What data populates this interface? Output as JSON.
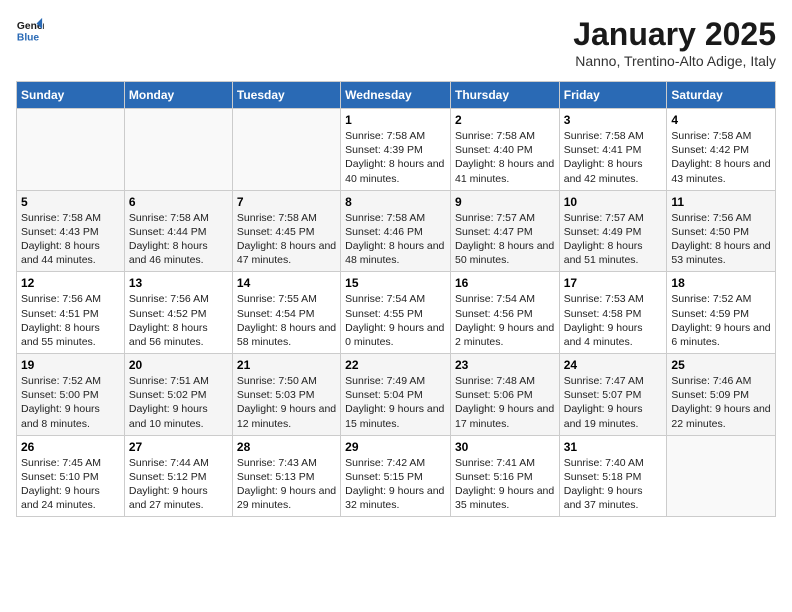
{
  "header": {
    "logo_line1": "General",
    "logo_line2": "Blue",
    "month": "January 2025",
    "location": "Nanno, Trentino-Alto Adige, Italy"
  },
  "weekdays": [
    "Sunday",
    "Monday",
    "Tuesday",
    "Wednesday",
    "Thursday",
    "Friday",
    "Saturday"
  ],
  "weeks": [
    [
      {
        "day": "",
        "content": ""
      },
      {
        "day": "",
        "content": ""
      },
      {
        "day": "",
        "content": ""
      },
      {
        "day": "1",
        "content": "Sunrise: 7:58 AM\nSunset: 4:39 PM\nDaylight: 8 hours and 40 minutes."
      },
      {
        "day": "2",
        "content": "Sunrise: 7:58 AM\nSunset: 4:40 PM\nDaylight: 8 hours and 41 minutes."
      },
      {
        "day": "3",
        "content": "Sunrise: 7:58 AM\nSunset: 4:41 PM\nDaylight: 8 hours and 42 minutes."
      },
      {
        "day": "4",
        "content": "Sunrise: 7:58 AM\nSunset: 4:42 PM\nDaylight: 8 hours and 43 minutes."
      }
    ],
    [
      {
        "day": "5",
        "content": "Sunrise: 7:58 AM\nSunset: 4:43 PM\nDaylight: 8 hours and 44 minutes."
      },
      {
        "day": "6",
        "content": "Sunrise: 7:58 AM\nSunset: 4:44 PM\nDaylight: 8 hours and 46 minutes."
      },
      {
        "day": "7",
        "content": "Sunrise: 7:58 AM\nSunset: 4:45 PM\nDaylight: 8 hours and 47 minutes."
      },
      {
        "day": "8",
        "content": "Sunrise: 7:58 AM\nSunset: 4:46 PM\nDaylight: 8 hours and 48 minutes."
      },
      {
        "day": "9",
        "content": "Sunrise: 7:57 AM\nSunset: 4:47 PM\nDaylight: 8 hours and 50 minutes."
      },
      {
        "day": "10",
        "content": "Sunrise: 7:57 AM\nSunset: 4:49 PM\nDaylight: 8 hours and 51 minutes."
      },
      {
        "day": "11",
        "content": "Sunrise: 7:56 AM\nSunset: 4:50 PM\nDaylight: 8 hours and 53 minutes."
      }
    ],
    [
      {
        "day": "12",
        "content": "Sunrise: 7:56 AM\nSunset: 4:51 PM\nDaylight: 8 hours and 55 minutes."
      },
      {
        "day": "13",
        "content": "Sunrise: 7:56 AM\nSunset: 4:52 PM\nDaylight: 8 hours and 56 minutes."
      },
      {
        "day": "14",
        "content": "Sunrise: 7:55 AM\nSunset: 4:54 PM\nDaylight: 8 hours and 58 minutes."
      },
      {
        "day": "15",
        "content": "Sunrise: 7:54 AM\nSunset: 4:55 PM\nDaylight: 9 hours and 0 minutes."
      },
      {
        "day": "16",
        "content": "Sunrise: 7:54 AM\nSunset: 4:56 PM\nDaylight: 9 hours and 2 minutes."
      },
      {
        "day": "17",
        "content": "Sunrise: 7:53 AM\nSunset: 4:58 PM\nDaylight: 9 hours and 4 minutes."
      },
      {
        "day": "18",
        "content": "Sunrise: 7:52 AM\nSunset: 4:59 PM\nDaylight: 9 hours and 6 minutes."
      }
    ],
    [
      {
        "day": "19",
        "content": "Sunrise: 7:52 AM\nSunset: 5:00 PM\nDaylight: 9 hours and 8 minutes."
      },
      {
        "day": "20",
        "content": "Sunrise: 7:51 AM\nSunset: 5:02 PM\nDaylight: 9 hours and 10 minutes."
      },
      {
        "day": "21",
        "content": "Sunrise: 7:50 AM\nSunset: 5:03 PM\nDaylight: 9 hours and 12 minutes."
      },
      {
        "day": "22",
        "content": "Sunrise: 7:49 AM\nSunset: 5:04 PM\nDaylight: 9 hours and 15 minutes."
      },
      {
        "day": "23",
        "content": "Sunrise: 7:48 AM\nSunset: 5:06 PM\nDaylight: 9 hours and 17 minutes."
      },
      {
        "day": "24",
        "content": "Sunrise: 7:47 AM\nSunset: 5:07 PM\nDaylight: 9 hours and 19 minutes."
      },
      {
        "day": "25",
        "content": "Sunrise: 7:46 AM\nSunset: 5:09 PM\nDaylight: 9 hours and 22 minutes."
      }
    ],
    [
      {
        "day": "26",
        "content": "Sunrise: 7:45 AM\nSunset: 5:10 PM\nDaylight: 9 hours and 24 minutes."
      },
      {
        "day": "27",
        "content": "Sunrise: 7:44 AM\nSunset: 5:12 PM\nDaylight: 9 hours and 27 minutes."
      },
      {
        "day": "28",
        "content": "Sunrise: 7:43 AM\nSunset: 5:13 PM\nDaylight: 9 hours and 29 minutes."
      },
      {
        "day": "29",
        "content": "Sunrise: 7:42 AM\nSunset: 5:15 PM\nDaylight: 9 hours and 32 minutes."
      },
      {
        "day": "30",
        "content": "Sunrise: 7:41 AM\nSunset: 5:16 PM\nDaylight: 9 hours and 35 minutes."
      },
      {
        "day": "31",
        "content": "Sunrise: 7:40 AM\nSunset: 5:18 PM\nDaylight: 9 hours and 37 minutes."
      },
      {
        "day": "",
        "content": ""
      }
    ]
  ]
}
